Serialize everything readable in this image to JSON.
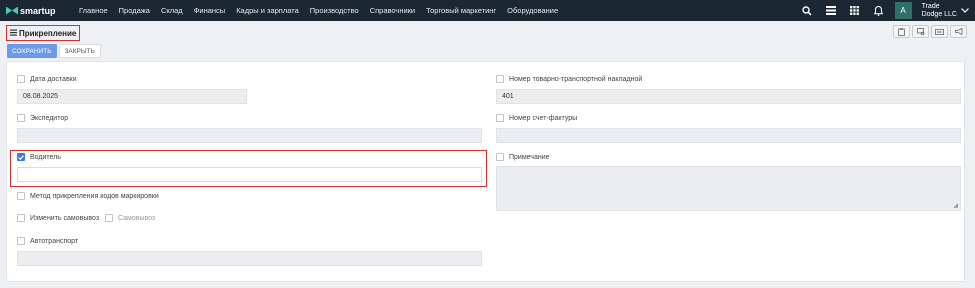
{
  "app": {
    "logo": "smartup"
  },
  "nav": {
    "menu": [
      "Главное",
      "Продажа",
      "Склад",
      "Финансы",
      "Кадры и зарплата",
      "Производство",
      "Справочники",
      "Торговый маркетинг",
      "Оборудование"
    ],
    "avatar_letter": "A",
    "user_line1": "Trade",
    "user_line2": "Dodge LLC"
  },
  "page": {
    "title": "Прикрепление"
  },
  "actions": {
    "save": "СОХРАНИТЬ",
    "close": "ЗАКРЫТЬ"
  },
  "form": {
    "delivery_date": {
      "label": "Дата доставки",
      "value": "08.08.2025"
    },
    "waybill": {
      "label": "Номер товарно-транспортной накладной",
      "value": "401"
    },
    "forwarder": {
      "label": "Экспедитор",
      "value": ""
    },
    "invoice": {
      "label": "Номер счет-фактуры",
      "value": ""
    },
    "driver": {
      "label": "Водитель",
      "value": "",
      "checked": true
    },
    "note": {
      "label": "Примечание",
      "value": ""
    },
    "marking_method": {
      "label": "Метод прикрепления кодов маркировки"
    },
    "change_pickup": {
      "label": "Изменить самовывоз"
    },
    "pickup": {
      "label": "Самовывоз"
    },
    "vehicle": {
      "label": "Автотранспорт",
      "value": ""
    }
  },
  "colors": {
    "nav_bg": "#1b2733",
    "accent": "#3d7ad9",
    "highlight": "#d9302b"
  }
}
